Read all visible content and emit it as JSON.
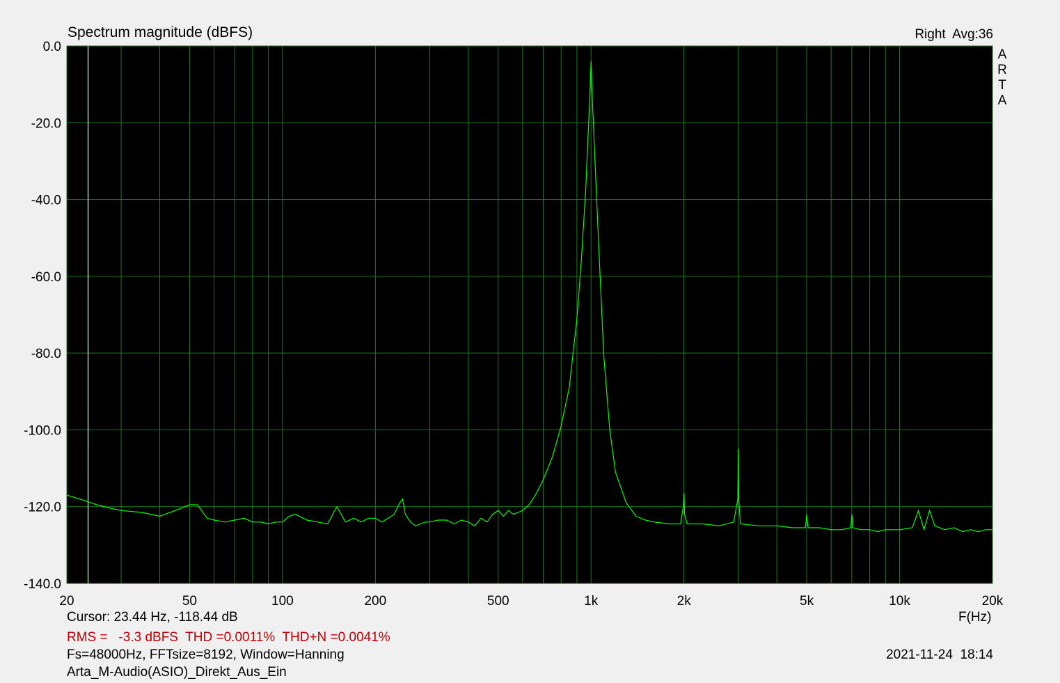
{
  "header": {
    "title": "Spectrum magnitude (dBFS)",
    "channel_avg": "Right  Avg:36",
    "watermark": [
      "A",
      "R",
      "T",
      "A"
    ]
  },
  "footer": {
    "cursor": "Cursor: 23.44 Hz, -118.44 dB",
    "xunit": "F(Hz)",
    "stats": "RMS =   -3.3 dBFS  THD =0.0011%  THD+N =0.0041%",
    "params": "Fs=48000Hz, FFTsize=8192, Window=Hanning",
    "datetime": "2021-11-24  18:14",
    "filename": "Arta_M-Audio(ASIO)_Direkt_Aus_Ein"
  },
  "colors": {
    "plot_bg": "#000000",
    "grid": "#1f7a1f",
    "trace": "#00ff00",
    "cursor": "#e8ffe8",
    "stats_text": "#c00000"
  },
  "chart_data": {
    "type": "line",
    "title": "Spectrum magnitude (dBFS)",
    "xlabel": "F(Hz)",
    "ylabel": "",
    "x_scale": "log",
    "xlim": [
      20,
      20000
    ],
    "ylim": [
      -140,
      0
    ],
    "grid": true,
    "x_tick_labels": [
      {
        "value": 20,
        "label": "20"
      },
      {
        "value": 50,
        "label": "50"
      },
      {
        "value": 100,
        "label": "100"
      },
      {
        "value": 200,
        "label": "200"
      },
      {
        "value": 500,
        "label": "500"
      },
      {
        "value": 1000,
        "label": "1k"
      },
      {
        "value": 2000,
        "label": "2k"
      },
      {
        "value": 5000,
        "label": "5k"
      },
      {
        "value": 10000,
        "label": "10k"
      },
      {
        "value": 20000,
        "label": "20k"
      }
    ],
    "y_tick_labels": [
      {
        "value": 0,
        "label": "0.0"
      },
      {
        "value": -20,
        "label": "-20.0"
      },
      {
        "value": -40,
        "label": "-40.0"
      },
      {
        "value": -60,
        "label": "-60.0"
      },
      {
        "value": -80,
        "label": "-80.0"
      },
      {
        "value": -100,
        "label": "-100.0"
      },
      {
        "value": -120,
        "label": "-120.0"
      },
      {
        "value": -140,
        "label": "-140.0"
      }
    ],
    "cursor": {
      "x": 23.44,
      "y": -118.44
    },
    "series": [
      {
        "x": [
          20,
          22,
          25,
          28,
          30,
          35,
          40,
          45,
          50,
          53,
          57,
          60,
          65,
          70,
          75,
          80,
          85,
          90,
          95,
          100,
          105,
          110,
          120,
          130,
          140,
          150,
          160,
          170,
          180,
          190,
          200,
          210,
          220,
          230,
          240,
          245,
          250,
          260,
          270,
          280,
          290,
          300,
          320,
          340,
          360,
          380,
          400,
          420,
          440,
          460,
          480,
          500,
          520,
          540,
          560,
          580,
          600,
          630,
          660,
          700,
          750,
          800,
          850,
          900,
          930,
          960,
          980,
          990,
          1000,
          1010,
          1020,
          1040,
          1070,
          1100,
          1150,
          1200,
          1300,
          1400,
          1500,
          1600,
          1800,
          1950,
          1990,
          2000,
          2010,
          2050,
          2300,
          2600,
          2900,
          2990,
          3000,
          3010,
          3050,
          3500,
          4000,
          4500,
          4950,
          5000,
          5050,
          5500,
          6000,
          6500,
          6950,
          7000,
          7050,
          7500,
          8000,
          8500,
          9000,
          10000,
          11000,
          11500,
          12000,
          12500,
          13000,
          14000,
          15000,
          16000,
          17000,
          18000,
          19000,
          20000
        ],
        "y": [
          -117,
          -118,
          -119.5,
          -120.5,
          -121,
          -121.5,
          -122.5,
          -121,
          -119.5,
          -119.5,
          -123,
          -123.5,
          -124,
          -123.5,
          -123,
          -124,
          -124,
          -124.5,
          -124,
          -124,
          -122.5,
          -122,
          -123.5,
          -124,
          -124.5,
          -120,
          -124,
          -123,
          -124,
          -123,
          -123,
          -124,
          -123,
          -122,
          -119,
          -118,
          -122,
          -124,
          -125,
          -124.5,
          -124,
          -124,
          -123.5,
          -123.5,
          -124.5,
          -123.5,
          -124,
          -125,
          -123,
          -124,
          -122,
          -121,
          -122.5,
          -121,
          -122,
          -121.5,
          -121,
          -119.5,
          -117,
          -113,
          -107,
          -99,
          -89,
          -71,
          -56,
          -38,
          -22,
          -14,
          -4,
          -14,
          -22,
          -38,
          -60,
          -81,
          -100,
          -111,
          -119,
          -122.5,
          -123.5,
          -124,
          -124.5,
          -124.5,
          -120,
          -116.5,
          -122,
          -124.5,
          -124.5,
          -125,
          -124,
          -118,
          -105,
          -118,
          -124.5,
          -125,
          -125,
          -125.5,
          -125.5,
          -122,
          -125.5,
          -125.5,
          -126,
          -126,
          -125.5,
          -122,
          -125.5,
          -126,
          -126,
          -126.5,
          -126,
          -126,
          -125.5,
          -121,
          -126,
          -121,
          -125,
          -126,
          -125.5,
          -126.5,
          -126,
          -126.5,
          -126,
          -126
        ]
      }
    ]
  }
}
